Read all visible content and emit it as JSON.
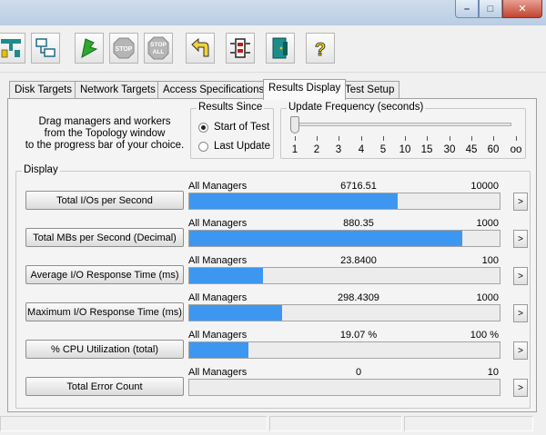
{
  "window": {
    "controls": {
      "minimize": "–",
      "maximize": "□",
      "close": "✕"
    }
  },
  "toolbar": {
    "buttons": [
      {
        "name": "topology",
        "label": ""
      },
      {
        "name": "new-manager",
        "label": ""
      },
      {
        "name": "start",
        "label": ""
      },
      {
        "name": "stop",
        "label": "STOP"
      },
      {
        "name": "stop-all",
        "label_top": "STOP",
        "label_bottom": "ALL"
      },
      {
        "name": "reset-workers",
        "label": ""
      },
      {
        "name": "disk-test",
        "label": ""
      },
      {
        "name": "exit",
        "label": ""
      },
      {
        "name": "help",
        "label": "?"
      }
    ]
  },
  "tabs": [
    "Disk Targets",
    "Network Targets",
    "Access Specifications",
    "Results Display",
    "Test Setup"
  ],
  "active_tab": "Results Display",
  "hint": {
    "line1": "Drag managers and workers",
    "line2": "from the Topology window",
    "line3": "to the progress bar of your choice."
  },
  "results_since": {
    "title": "Results Since",
    "options": [
      "Start of Test",
      "Last Update"
    ],
    "selected": "Start of Test"
  },
  "update_frequency": {
    "title": "Update Frequency (seconds)",
    "ticks": [
      "1",
      "2",
      "3",
      "4",
      "5",
      "10",
      "15",
      "30",
      "45",
      "60",
      "oo"
    ],
    "selected_index": 0
  },
  "display": {
    "title": "Display",
    "rows": [
      {
        "button": "Total I/Os per Second",
        "source": "All Managers",
        "value": "6716.51",
        "max": "10000",
        "fill": 0.6717
      },
      {
        "button": "Total MBs per Second (Decimal)",
        "source": "All Managers",
        "value": "880.35",
        "max": "1000",
        "fill": 0.8804
      },
      {
        "button": "Average I/O Response Time (ms)",
        "source": "All Managers",
        "value": "23.8400",
        "max": "100",
        "fill": 0.2384
      },
      {
        "button": "Maximum I/O Response Time (ms)",
        "source": "All Managers",
        "value": "298.4309",
        "max": "1000",
        "fill": 0.2984
      },
      {
        "button": "% CPU Utilization (total)",
        "source": "All Managers",
        "value": "19.07 %",
        "max": "100 %",
        "fill": 0.1907
      },
      {
        "button": "Total Error Count",
        "source": "All Managers",
        "value": "0",
        "max": "10",
        "fill": 0
      }
    ],
    "more_glyph": ">"
  },
  "colors": {
    "bar_fill": "#3d97f0"
  }
}
